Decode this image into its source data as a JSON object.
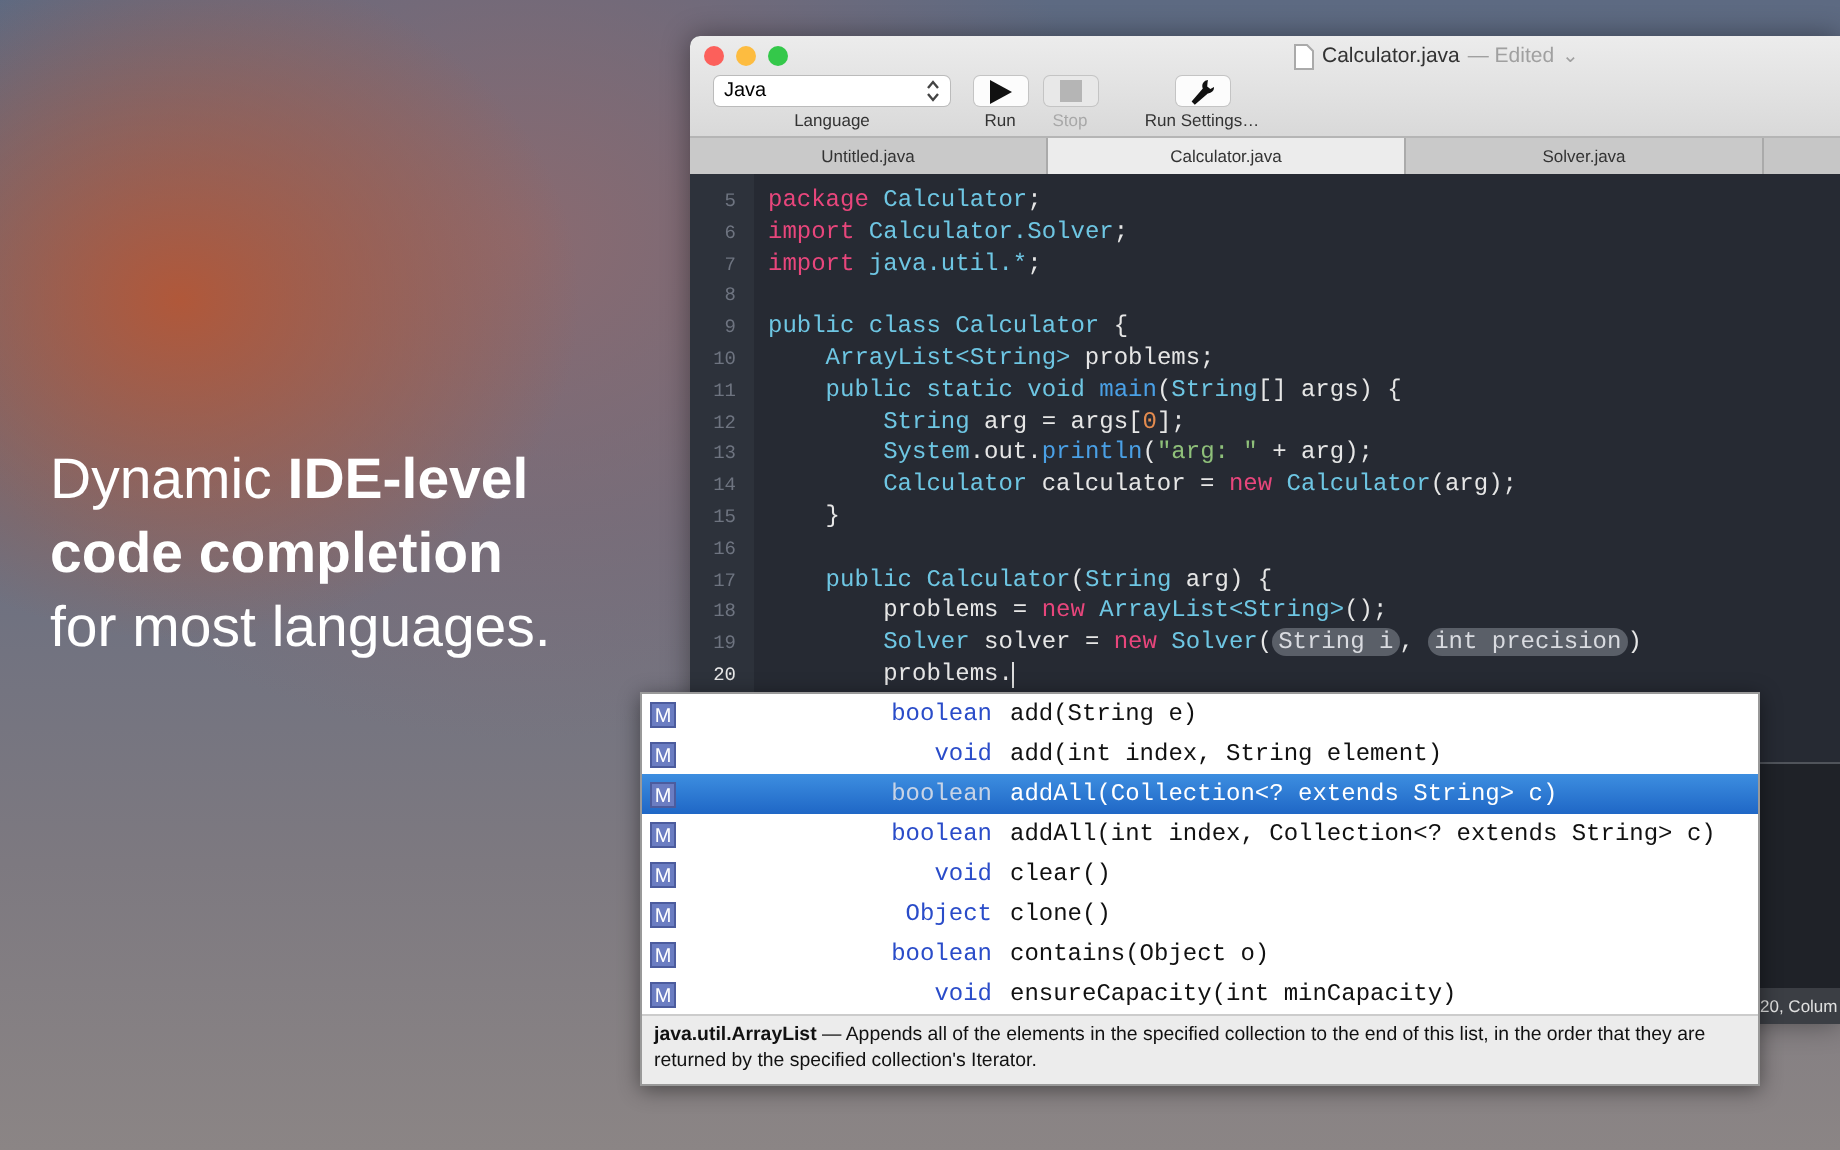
{
  "headline": {
    "lines": [
      "Dynamic **IDE-level**",
      "**code completion**",
      "for most languages."
    ]
  },
  "window": {
    "title": "Calculator.java",
    "edited": "— Edited",
    "edited_caret": "⌄"
  },
  "toolbar": {
    "language": {
      "value": "Java",
      "label": "Language"
    },
    "buttons": [
      {
        "kind": "run",
        "label": "Run",
        "disabled": false
      },
      {
        "kind": "stop",
        "label": "Stop",
        "disabled": true
      },
      {
        "kind": "settings",
        "label": "Run Settings…",
        "disabled": false
      }
    ]
  },
  "tabs": [
    {
      "label": "Untitled.java",
      "selected": false
    },
    {
      "label": "Calculator.java",
      "selected": true
    },
    {
      "label": "Solver.java",
      "selected": false
    }
  ],
  "code_lines": [
    {
      "number": "5",
      "current": false,
      "tokens": [
        {
          "kind": "keyword",
          "text": "package"
        },
        {
          "kind": "type",
          "text": " Calculator"
        },
        {
          "kind": "plain",
          "text": ";"
        }
      ]
    },
    {
      "number": "6",
      "current": false,
      "tokens": [
        {
          "kind": "keyword",
          "text": "import"
        },
        {
          "kind": "type",
          "text": " Calculator.Solver"
        },
        {
          "kind": "plain",
          "text": ";"
        }
      ]
    },
    {
      "number": "7",
      "current": false,
      "tokens": [
        {
          "kind": "keyword",
          "text": "import"
        },
        {
          "kind": "type",
          "text": " java.util.*"
        },
        {
          "kind": "plain",
          "text": ";"
        }
      ]
    },
    {
      "number": "8",
      "current": false
    },
    {
      "number": "9",
      "current": false,
      "tokens": [
        {
          "kind": "type",
          "text": "public class Calculator"
        },
        {
          "kind": "plain",
          "text": " {"
        }
      ]
    },
    {
      "number": "10",
      "current": false,
      "tokens": [
        {
          "kind": "type",
          "text": "    ArrayList<String>"
        },
        {
          "kind": "plain",
          "text": " problems;"
        }
      ]
    },
    {
      "number": "11",
      "current": false,
      "tokens": [
        {
          "kind": "type",
          "text": "    public static void "
        },
        {
          "kind": "method",
          "text": "main"
        },
        {
          "kind": "plain",
          "text": "("
        },
        {
          "kind": "type",
          "text": "String"
        },
        {
          "kind": "plain",
          "text": "[] args) {"
        }
      ]
    },
    {
      "number": "12",
      "current": false,
      "tokens": [
        {
          "kind": "type",
          "text": "        String"
        },
        {
          "kind": "plain",
          "text": " arg = args["
        },
        {
          "kind": "number",
          "text": "0"
        },
        {
          "kind": "plain",
          "text": "];"
        }
      ]
    },
    {
      "number": "13",
      "current": false,
      "tokens": [
        {
          "kind": "type",
          "text": "        System"
        },
        {
          "kind": "plain",
          "text": ".out."
        },
        {
          "kind": "method",
          "text": "println"
        },
        {
          "kind": "plain",
          "text": "("
        },
        {
          "kind": "string",
          "text": "\"arg: \""
        },
        {
          "kind": "plain",
          "text": " + arg);"
        }
      ]
    },
    {
      "number": "14",
      "current": false,
      "tokens": [
        {
          "kind": "type",
          "text": "        Calculator"
        },
        {
          "kind": "plain",
          "text": " calculator = "
        },
        {
          "kind": "keyword",
          "text": "new"
        },
        {
          "kind": "type",
          "text": " Calculator"
        },
        {
          "kind": "plain",
          "text": "(arg);"
        }
      ]
    },
    {
      "number": "15",
      "current": false,
      "tokens": [
        {
          "kind": "plain",
          "text": "    }"
        }
      ]
    },
    {
      "number": "16",
      "current": false
    },
    {
      "number": "17",
      "current": false,
      "tokens": [
        {
          "kind": "type",
          "text": "    public Calculator"
        },
        {
          "kind": "plain",
          "text": "("
        },
        {
          "kind": "type",
          "text": "String"
        },
        {
          "kind": "plain",
          "text": " arg) {"
        }
      ]
    },
    {
      "number": "18",
      "current": false,
      "tokens": [
        {
          "kind": "plain",
          "text": "        problems = "
        },
        {
          "kind": "keyword",
          "text": "new"
        },
        {
          "kind": "type",
          "text": " ArrayList<String>"
        },
        {
          "kind": "plain",
          "text": "();"
        }
      ]
    },
    {
      "number": "19",
      "current": false,
      "tokens": [
        {
          "kind": "type",
          "text": "        Solver"
        },
        {
          "kind": "plain",
          "text": " solver = "
        },
        {
          "kind": "keyword",
          "text": "new"
        },
        {
          "kind": "type",
          "text": " Solver"
        },
        {
          "kind": "plain",
          "text": "("
        },
        {
          "kind": "hint",
          "text": "String i"
        },
        {
          "kind": "plain",
          "text": ", "
        },
        {
          "kind": "hint",
          "text": "int precision"
        },
        {
          "kind": "plain",
          "text": ")"
        }
      ]
    },
    {
      "number": "20",
      "current": true,
      "tokens": [
        {
          "kind": "plain",
          "text": "        problems."
        }
      ]
    }
  ],
  "status_bar": {
    "text": "20, Colum"
  },
  "completions": {
    "items": [
      {
        "icon": "M",
        "return_type": "boolean",
        "signature": "add(String e)",
        "selected": false
      },
      {
        "icon": "M",
        "return_type": "void",
        "signature": "add(int index, String element)",
        "selected": false
      },
      {
        "icon": "M",
        "return_type": "boolean",
        "signature": "addAll(Collection<? extends String> c)",
        "selected": true
      },
      {
        "icon": "M",
        "return_type": "boolean",
        "signature": "addAll(int index, Collection<? extends String> c)",
        "selected": false
      },
      {
        "icon": "M",
        "return_type": "void",
        "signature": "clear()",
        "selected": false
      },
      {
        "icon": "M",
        "return_type": "Object",
        "signature": "clone()",
        "selected": false
      },
      {
        "icon": "M",
        "return_type": "boolean",
        "signature": "contains(Object o)",
        "selected": false
      },
      {
        "icon": "M",
        "return_type": "void",
        "signature": "ensureCapacity(int minCapacity)",
        "selected": false
      }
    ],
    "description": "**java.util.ArrayList** — Appends all of the elements in the specified collection to the end of this list, in the order that they are returned by the specified collection's Iterator."
  }
}
